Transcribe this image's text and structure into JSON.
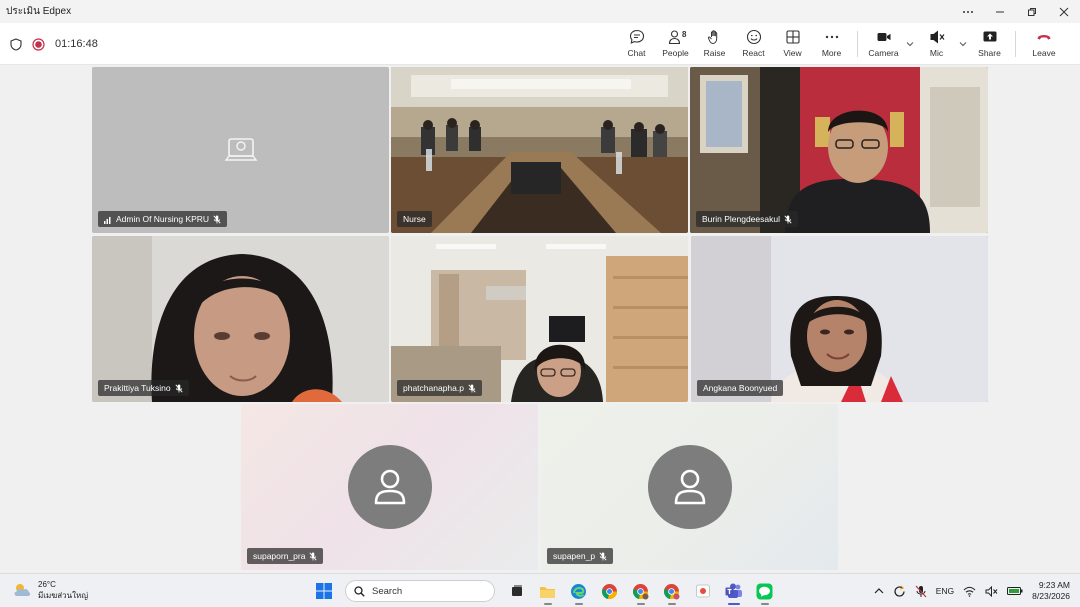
{
  "window": {
    "title": "ประเมิน Edpex",
    "controls": [
      "more-icon",
      "minimize-icon",
      "restore-icon",
      "close-icon"
    ]
  },
  "meeting": {
    "elapsed": "01:16:48",
    "accent_color": "#6264a7",
    "leave_color": "#c4314b"
  },
  "toolbar": {
    "chat": "Chat",
    "people": "People",
    "people_count": "8",
    "raise": "Raise",
    "react": "React",
    "view": "View",
    "more": "More",
    "camera": "Camera",
    "mic": "Mic",
    "share": "Share",
    "leave": "Leave"
  },
  "participants": [
    {
      "name": "Admin Of Nursing KPRU",
      "video": "room-system",
      "muted": true
    },
    {
      "name": "Nurse",
      "video": "on",
      "muted": false
    },
    {
      "name": "Burin Plengdeesakul",
      "video": "on",
      "muted": true
    },
    {
      "name": "Prakittiya Tuksino",
      "video": "on",
      "muted": true
    },
    {
      "name": "phatchanapha.p",
      "video": "on",
      "muted": true
    },
    {
      "name": "Angkana Boonyued",
      "video": "on",
      "muted": false,
      "speaking": true
    },
    {
      "name": "supaporn_pra",
      "video": "off",
      "muted": true
    },
    {
      "name": "supapen_p",
      "video": "off",
      "muted": true
    }
  ],
  "taskbar": {
    "weather_temp": "26°C",
    "weather_desc": "มีเมฆส่วนใหญ่",
    "search_label": "Search",
    "language": "ENG",
    "time": "9:23 AM",
    "date": "8/23/2026",
    "apps": [
      "start-icon",
      "search-icon",
      "task-view-icon",
      "file-explorer-icon",
      "edge-icon",
      "chrome-icon",
      "chrome-profile-icon",
      "chrome-profile-icon",
      "photos-icon",
      "teams-icon",
      "line-icon"
    ]
  }
}
